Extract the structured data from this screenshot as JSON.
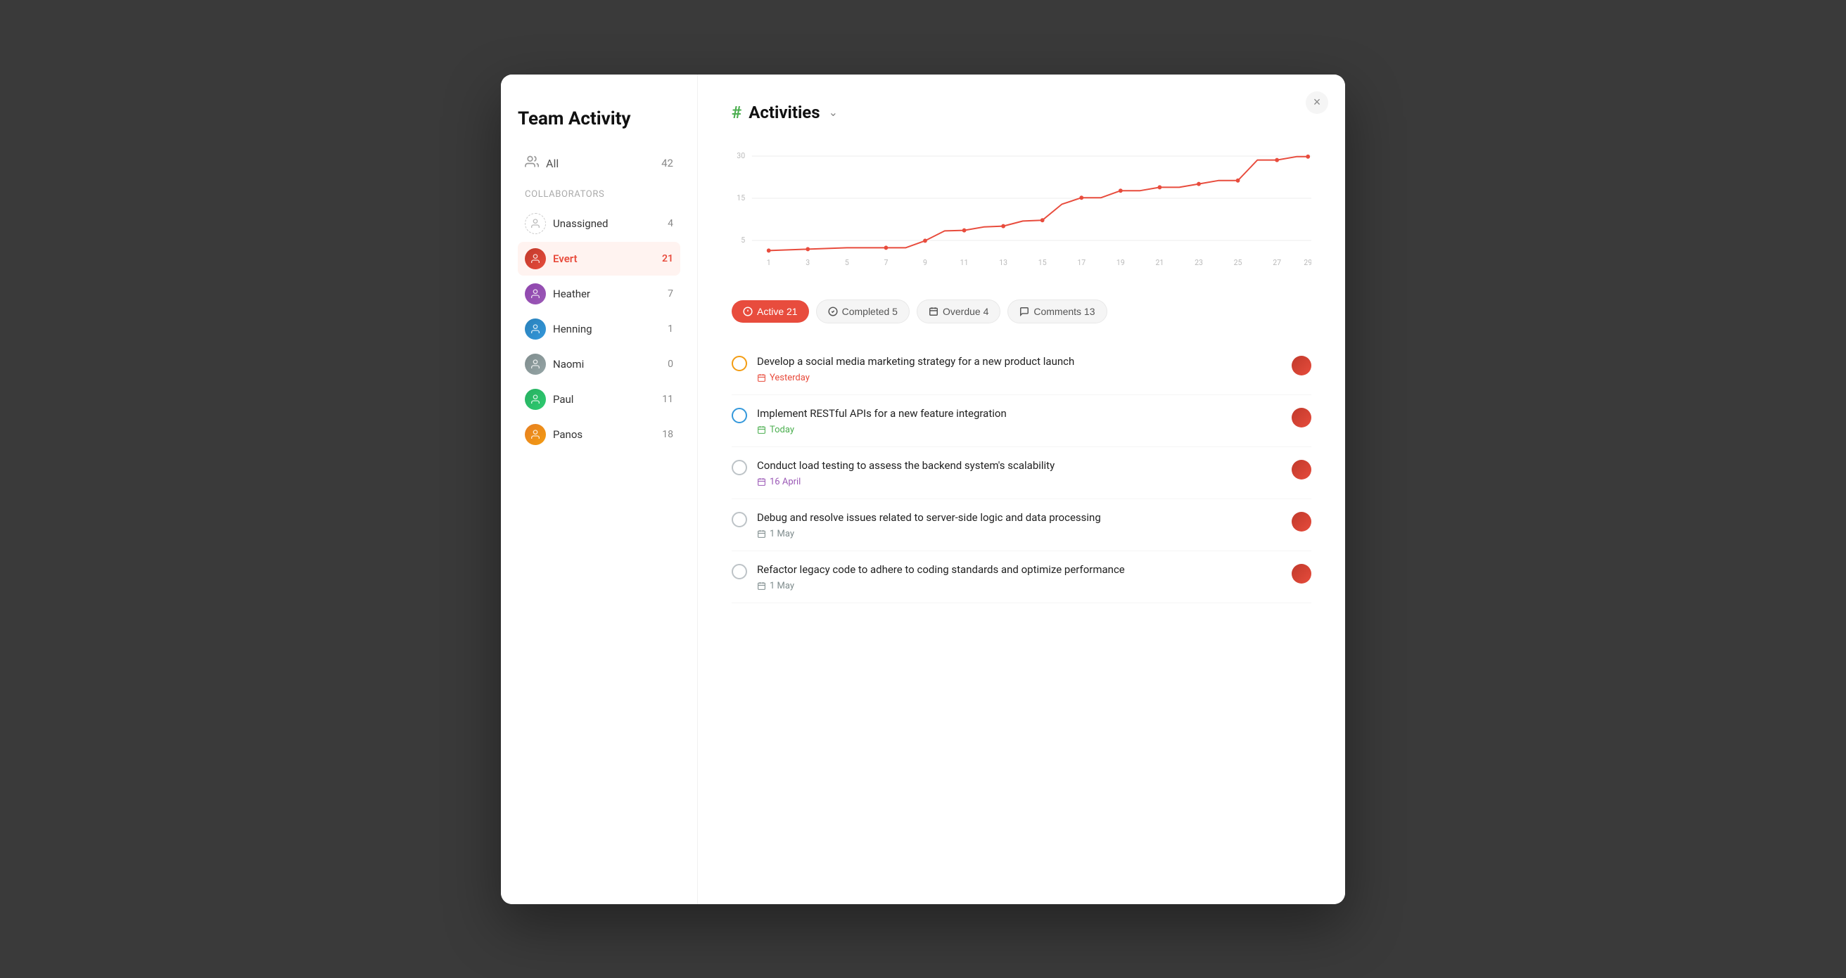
{
  "window": {
    "title": "Team Activity"
  },
  "sidebar": {
    "title": "Team Activity",
    "all_label": "All",
    "all_count": "42",
    "collaborators_label": "Collaborators",
    "members": [
      {
        "id": "unassigned",
        "name": "Unassigned",
        "count": "4",
        "active": false
      },
      {
        "id": "evert",
        "name": "Evert",
        "count": "21",
        "active": true
      },
      {
        "id": "heather",
        "name": "Heather",
        "count": "7",
        "active": false
      },
      {
        "id": "henning",
        "name": "Henning",
        "count": "1",
        "active": false
      },
      {
        "id": "naomi",
        "name": "Naomi",
        "count": "0",
        "active": false
      },
      {
        "id": "paul",
        "name": "Paul",
        "count": "11",
        "active": false
      },
      {
        "id": "panos",
        "name": "Panos",
        "count": "18",
        "active": false
      }
    ]
  },
  "main": {
    "section_icon": "#",
    "section_title": "Activities",
    "chart": {
      "x_labels": [
        "1",
        "3",
        "5",
        "7",
        "9",
        "11",
        "13",
        "15",
        "17",
        "19",
        "21",
        "23",
        "25",
        "27",
        "29"
      ],
      "y_labels": [
        "5",
        "15",
        "30"
      ],
      "data_points": [
        2,
        2.5,
        3,
        3,
        3,
        5,
        7.5,
        8,
        9,
        9.5,
        11,
        11.5,
        17,
        19,
        19,
        21,
        21,
        22,
        22,
        23,
        24,
        24,
        29,
        29,
        30,
        30
      ]
    },
    "filter_tabs": [
      {
        "id": "active",
        "label": "Active 21",
        "active": true
      },
      {
        "id": "completed",
        "label": "Completed 5",
        "active": false
      },
      {
        "id": "overdue",
        "label": "Overdue 4",
        "active": false
      },
      {
        "id": "comments",
        "label": "Comments 13",
        "active": false
      }
    ],
    "tasks": [
      {
        "title": "Develop a social media marketing strategy for a new product launch",
        "date": "Yesterday",
        "date_type": "yesterday",
        "circle_type": "orange"
      },
      {
        "title": "Implement RESTful APIs for a new feature integration",
        "date": "Today",
        "date_type": "today",
        "circle_type": "blue"
      },
      {
        "title": "Conduct load testing to assess the backend system's scalability",
        "date": "16 April",
        "date_type": "april",
        "circle_type": "gray"
      },
      {
        "title": "Debug and resolve issues related to server-side logic and data processing",
        "date": "1 May",
        "date_type": "may",
        "circle_type": "gray"
      },
      {
        "title": "Refactor legacy code to adhere to coding standards and optimize performance",
        "date": "1 May",
        "date_type": "may",
        "circle_type": "gray"
      }
    ]
  },
  "close_label": "×",
  "icons": {
    "hash": "#",
    "users": "👥",
    "person": "👤",
    "calendar": "📅",
    "check_circle": "✓",
    "overdue_icon": "⊘",
    "comment_icon": "💬",
    "chevron_down": "⌄"
  }
}
